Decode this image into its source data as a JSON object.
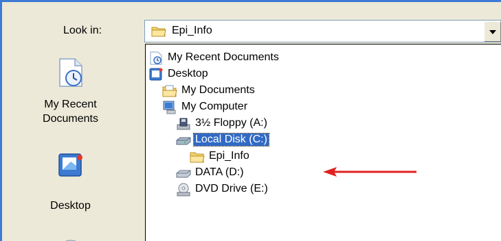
{
  "look_in": {
    "label": "Look in:",
    "value": "Epi_Info"
  },
  "places_bar": {
    "items": [
      {
        "label_line1": "My Recent",
        "label_line2": "Documents"
      },
      {
        "label": "Desktop"
      }
    ]
  },
  "dropdown": {
    "items": [
      {
        "label": "My Recent Documents",
        "icon": "recent-documents-icon"
      },
      {
        "label": "Desktop",
        "icon": "desktop-icon"
      },
      {
        "label": "My Documents",
        "icon": "folder-icon"
      },
      {
        "label": "My Computer",
        "icon": "computer-icon"
      },
      {
        "label": "3½ Floppy (A:)",
        "icon": "floppy-drive-icon"
      },
      {
        "label": "Local Disk (C:)",
        "icon": "hard-disk-icon",
        "selected": true
      },
      {
        "label": "Epi_Info",
        "icon": "folder-icon"
      },
      {
        "label": "DATA (D:)",
        "icon": "hard-disk-icon"
      },
      {
        "label": "DVD Drive (E:)",
        "icon": "dvd-drive-icon"
      }
    ]
  },
  "colors": {
    "selection": "#316AC5",
    "arrow": "#E02020",
    "dialog_background": "#ECE9D8"
  }
}
